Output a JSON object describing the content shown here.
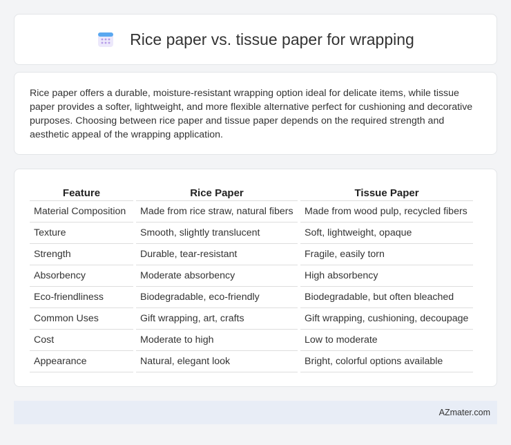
{
  "header": {
    "title": "Rice paper vs. tissue paper for wrapping",
    "icon": "calendar-icon"
  },
  "intro": {
    "text": "Rice paper offers a durable, moisture-resistant wrapping option ideal for delicate items, while tissue paper provides a softer, lightweight, and more flexible alternative perfect for cushioning and decorative purposes. Choosing between rice paper and tissue paper depends on the required strength and aesthetic appeal of the wrapping application."
  },
  "table": {
    "headers": [
      "Feature",
      "Rice Paper",
      "Tissue Paper"
    ],
    "rows": [
      [
        "Material Composition",
        "Made from rice straw, natural fibers",
        "Made from wood pulp, recycled fibers"
      ],
      [
        "Texture",
        "Smooth, slightly translucent",
        "Soft, lightweight, opaque"
      ],
      [
        "Strength",
        "Durable, tear-resistant",
        "Fragile, easily torn"
      ],
      [
        "Absorbency",
        "Moderate absorbency",
        "High absorbency"
      ],
      [
        "Eco-friendliness",
        "Biodegradable, eco-friendly",
        "Biodegradable, but often bleached"
      ],
      [
        "Common Uses",
        "Gift wrapping, art, crafts",
        "Gift wrapping, cushioning, decoupage"
      ],
      [
        "Cost",
        "Moderate to high",
        "Low to moderate"
      ],
      [
        "Appearance",
        "Natural, elegant look",
        "Bright, colorful options available"
      ]
    ]
  },
  "footer": {
    "brand": "AZmater.com"
  }
}
